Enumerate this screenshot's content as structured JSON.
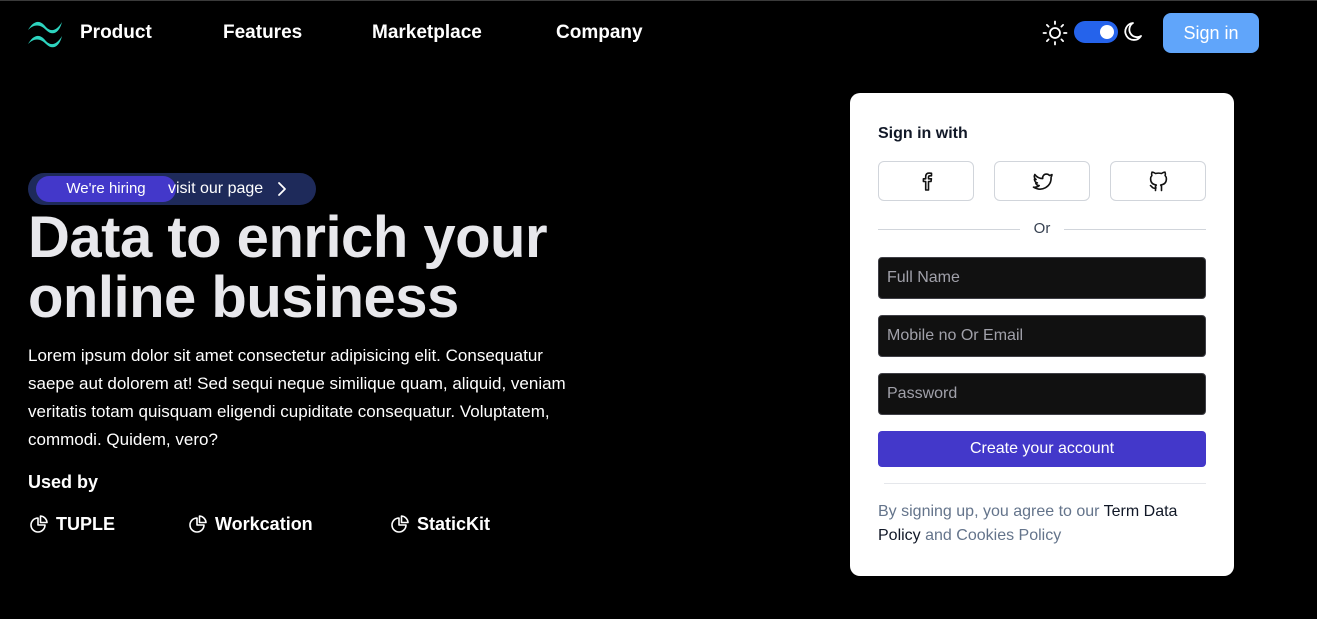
{
  "nav": {
    "links": [
      "Product",
      "Features",
      "Marketplace",
      "Company"
    ],
    "signin_label": "Sign in",
    "theme_toggle_state": "dark",
    "colors": {
      "accent_blue": "#60a5fa",
      "toggle_blue": "#2563eb",
      "logo_teal": "#2dd4bf"
    }
  },
  "hero": {
    "badge": "We're hiring",
    "badge_link": "visit our page",
    "headline": "Data to enrich your online business",
    "lead": "Lorem ipsum dolor sit amet consectetur adipisicing elit. Consequatur saepe aut dolorem at! Sed sequi neque similique quam, aliquid, veniam veritatis totam quisquam eligendi cupiditate consequatur. Voluptatem, commodi. Quidem, vero?",
    "used_by_label": "Used by",
    "brands": [
      "TUPLE",
      "Workcation",
      "StaticKit"
    ]
  },
  "signup": {
    "title": "Sign in with",
    "social": [
      "facebook-icon",
      "twitter-icon",
      "github-icon"
    ],
    "or_label": "Or",
    "full_name_placeholder": "Full Name",
    "contact_placeholder": "Mobile no Or Email",
    "password_placeholder": "Password",
    "create_label": "Create your account",
    "terms_prefix": "By signing up, you agree to our ",
    "terms_link": "Term Data Policy",
    "terms_mid": " and ",
    "cookies_link": "Cookies Policy",
    "colors": {
      "primary": "#4338ca"
    }
  }
}
